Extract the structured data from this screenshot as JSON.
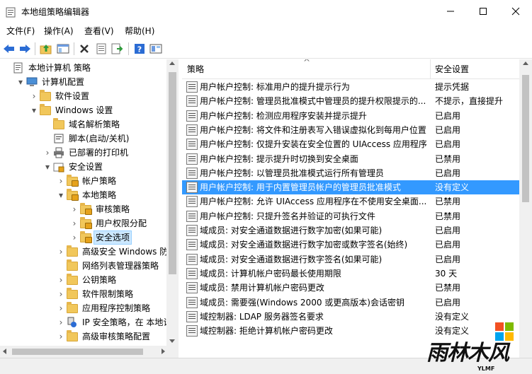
{
  "window": {
    "title": "本地组策略编辑器",
    "minimize_glyph": "—",
    "maximize_glyph": "☐",
    "close_glyph": "✕"
  },
  "menu": [
    "文件(F)",
    "操作(A)",
    "查看(V)",
    "帮助(H)"
  ],
  "toolbar": {
    "buttons": [
      "back-icon",
      "forward-icon",
      "up-folder-icon",
      "show-hide-tree-icon",
      "delete-icon",
      "properties-icon",
      "export-list-icon",
      "help-icon",
      "view-icon"
    ]
  },
  "tree": {
    "items": [
      {
        "label": "本地计算机 策略",
        "level": 0,
        "expand": "",
        "icon": "policy-doc-icon"
      },
      {
        "label": "计算机配置",
        "level": 1,
        "expand": "▾",
        "icon": "computer-icon"
      },
      {
        "label": "软件设置",
        "level": 2,
        "expand": "›",
        "icon": "folder-icon"
      },
      {
        "label": "Windows 设置",
        "level": 2,
        "expand": "▾",
        "icon": "folder-icon"
      },
      {
        "label": "域名解析策略",
        "level": 3,
        "expand": "",
        "icon": "folder-icon"
      },
      {
        "label": "脚本(启动/关机)",
        "level": 3,
        "expand": "",
        "icon": "script-icon"
      },
      {
        "label": "已部署的打印机",
        "level": 3,
        "expand": "›",
        "icon": "printer-icon"
      },
      {
        "label": "安全设置",
        "level": 3,
        "expand": "▾",
        "icon": "security-icon"
      },
      {
        "label": "帐户策略",
        "level": 4,
        "expand": "›",
        "icon": "lock-folder-icon"
      },
      {
        "label": "本地策略",
        "level": 4,
        "expand": "▾",
        "icon": "lock-folder-icon"
      },
      {
        "label": "审核策略",
        "level": 5,
        "expand": "›",
        "icon": "lock-folder-icon"
      },
      {
        "label": "用户权限分配",
        "level": 5,
        "expand": "›",
        "icon": "lock-folder-icon"
      },
      {
        "label": "安全选项",
        "level": 5,
        "expand": "›",
        "icon": "lock-folder-icon",
        "selected": true
      },
      {
        "label": "高级安全 Windows 防火",
        "level": 4,
        "expand": "›",
        "icon": "folder-icon"
      },
      {
        "label": "网络列表管理器策略",
        "level": 4,
        "expand": "",
        "icon": "folder-icon"
      },
      {
        "label": "公钥策略",
        "level": 4,
        "expand": "›",
        "icon": "folder-icon"
      },
      {
        "label": "软件限制策略",
        "level": 4,
        "expand": "›",
        "icon": "folder-icon"
      },
      {
        "label": "应用程序控制策略",
        "level": 4,
        "expand": "›",
        "icon": "folder-icon"
      },
      {
        "label": "IP 安全策略，在 本地计算",
        "level": 4,
        "expand": "›",
        "icon": "ip-security-icon"
      },
      {
        "label": "高级审核策略配置",
        "level": 4,
        "expand": "›",
        "icon": "folder-icon"
      }
    ]
  },
  "list": {
    "sort_indicator": "^",
    "columns": [
      "策略",
      "安全设置"
    ],
    "rows": [
      {
        "policy": "用户帐户控制: 标准用户的提升提示行为",
        "setting": "提示凭据"
      },
      {
        "policy": "用户帐户控制: 管理员批准模式中管理员的提升权限提示的...",
        "setting": "不提示，直接提升"
      },
      {
        "policy": "用户帐户控制: 检测应用程序安装并提示提升",
        "setting": "已启用"
      },
      {
        "policy": "用户帐户控制: 将文件和注册表写入错误虚拟化到每用户位置",
        "setting": "已启用"
      },
      {
        "policy": "用户帐户控制: 仅提升安装在安全位置的 UIAccess 应用程序",
        "setting": "已启用"
      },
      {
        "policy": "用户帐户控制: 提示提升时切换到安全桌面",
        "setting": "已禁用"
      },
      {
        "policy": "用户帐户控制: 以管理员批准模式运行所有管理员",
        "setting": "已启用"
      },
      {
        "policy": "用户帐户控制: 用于内置管理员帐户的管理员批准模式",
        "setting": "没有定义",
        "selected": true
      },
      {
        "policy": "用户帐户控制: 允许 UIAccess 应用程序在不使用安全桌面...",
        "setting": "已禁用"
      },
      {
        "policy": "用户帐户控制: 只提升签名并验证的可执行文件",
        "setting": "已禁用"
      },
      {
        "policy": "域成员: 对安全通道数据进行数字加密(如果可能)",
        "setting": "已启用"
      },
      {
        "policy": "域成员: 对安全通道数据进行数字加密或数字签名(始终)",
        "setting": "已启用"
      },
      {
        "policy": "域成员: 对安全通道数据进行数字签名(如果可能)",
        "setting": "已启用"
      },
      {
        "policy": "域成员: 计算机帐户密码最长使用期限",
        "setting": "30 天"
      },
      {
        "policy": "域成员: 禁用计算机帐户密码更改",
        "setting": "已禁用"
      },
      {
        "policy": "域成员: 需要强(Windows 2000 或更高版本)会话密钥",
        "setting": "已启用"
      },
      {
        "policy": "域控制器: LDAP 服务器签名要求",
        "setting": "没有定义"
      },
      {
        "policy": "域控制器: 拒绝计算机帐户密码更改",
        "setting": "没有定义"
      }
    ]
  },
  "watermark": {
    "text": "雨林木风",
    "subtext": "YLMF"
  },
  "colors": {
    "selection": "#3399ff",
    "tree_selection": "#cce8ff",
    "folder": "#f1c75b",
    "toolbar_blue": "#2b6cd4"
  }
}
